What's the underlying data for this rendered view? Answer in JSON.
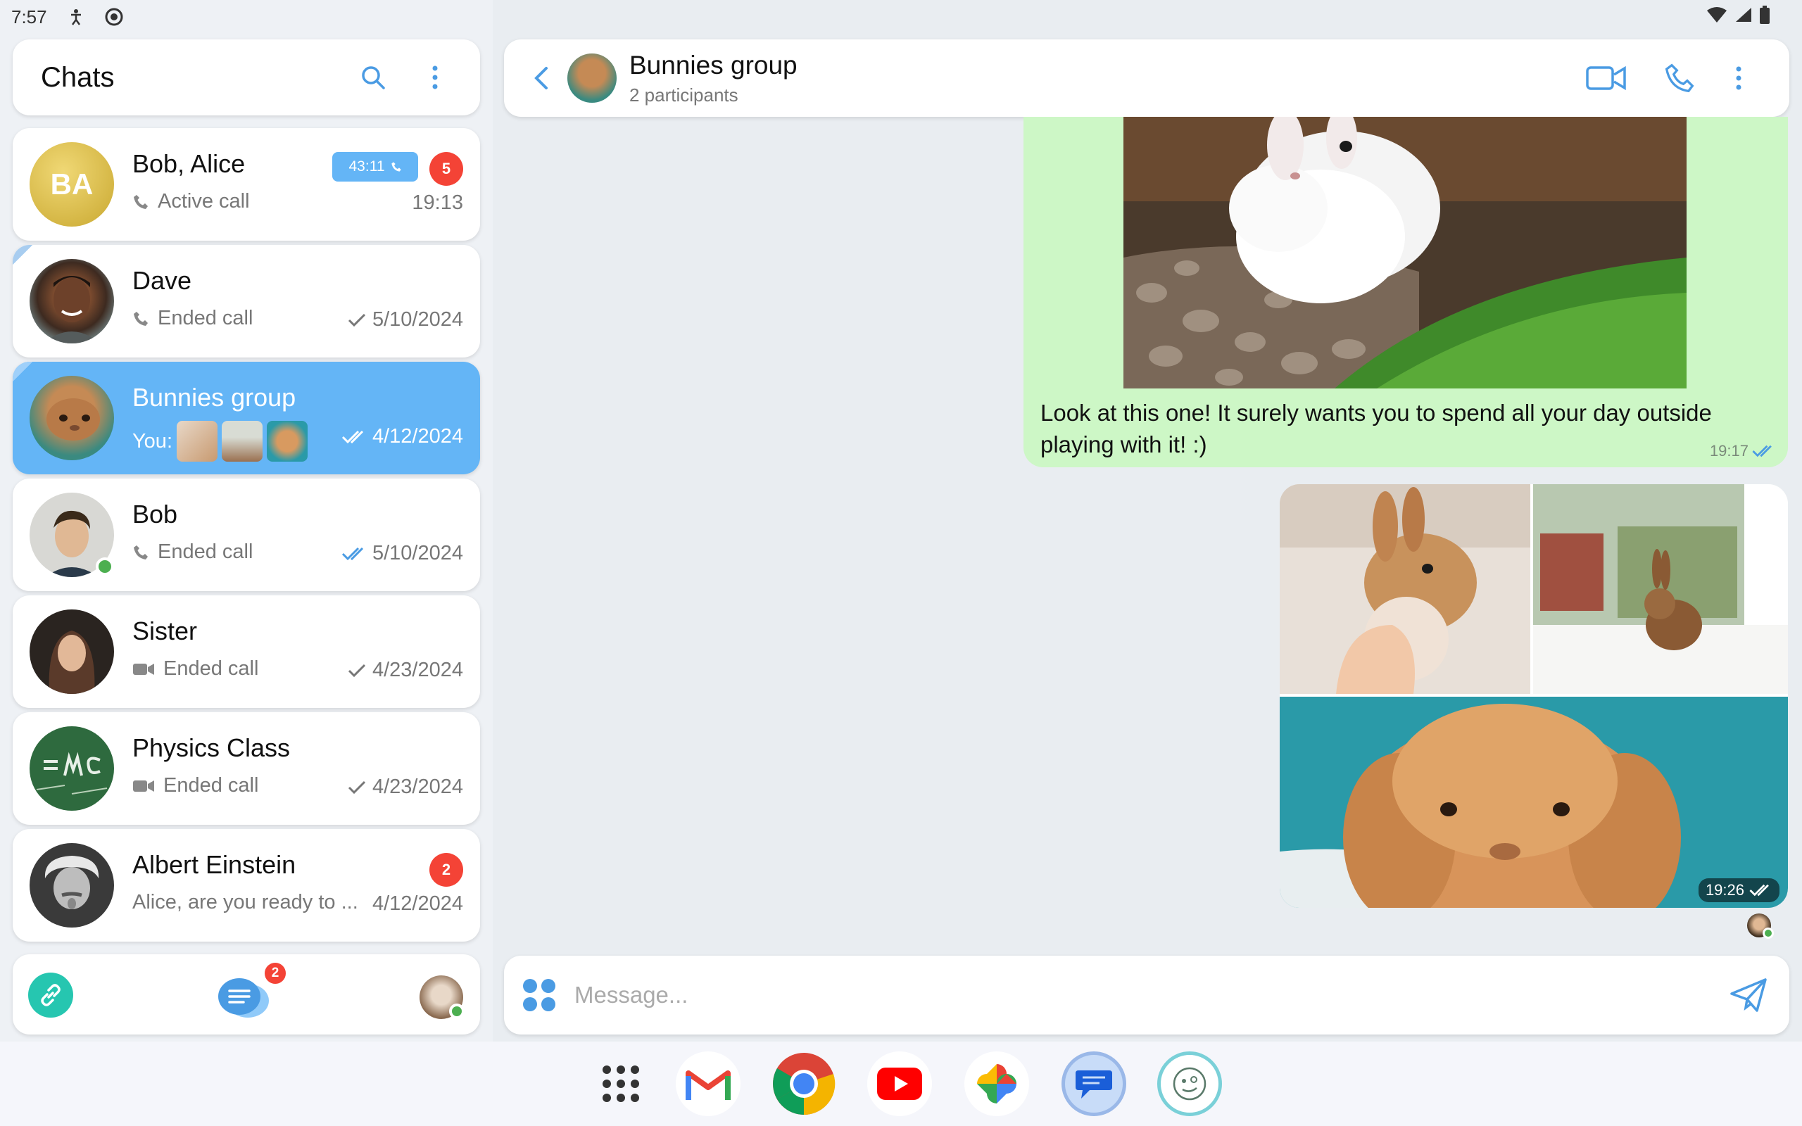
{
  "status_bar": {
    "time": "7:57"
  },
  "sidebar": {
    "title": "Chats",
    "chats": [
      {
        "name": "Bob, Alice",
        "initials": "BA",
        "preview": "Active call",
        "time": "19:13",
        "call_duration": "43:11",
        "unread": "5"
      },
      {
        "name": "Dave",
        "preview": "Ended call",
        "time": "5/10/2024"
      },
      {
        "name": "Bunnies group",
        "preview_prefix": "You:",
        "time": "4/12/2024"
      },
      {
        "name": "Bob",
        "preview": "Ended call",
        "time": "5/10/2024"
      },
      {
        "name": "Sister",
        "preview": "Ended call",
        "time": "4/23/2024"
      },
      {
        "name": "Physics Class",
        "preview": "Ended call",
        "time": "4/23/2024"
      },
      {
        "name": "Albert Einstein",
        "preview": "Alice, are you ready to ...",
        "time": "4/12/2024",
        "unread": "2"
      }
    ],
    "bottom_nav": {
      "chats_badge": "2"
    }
  },
  "conversation": {
    "name": "Bunnies group",
    "subtitle": "2 participants",
    "messages": [
      {
        "text": "Look at this one! It surely wants you to spend all your day outside playing with it! :)",
        "time": "19:17"
      },
      {
        "time": "19:26"
      }
    ]
  },
  "composer": {
    "placeholder": "Message..."
  },
  "colors": {
    "accent": "#64b5f6",
    "outgoing_bubble": "#cdf7c6",
    "badge": "#f44336",
    "online": "#4caf50"
  },
  "dock_apps": [
    "app-drawer",
    "gmail",
    "chrome",
    "youtube",
    "photos",
    "messages",
    "linphone"
  ]
}
